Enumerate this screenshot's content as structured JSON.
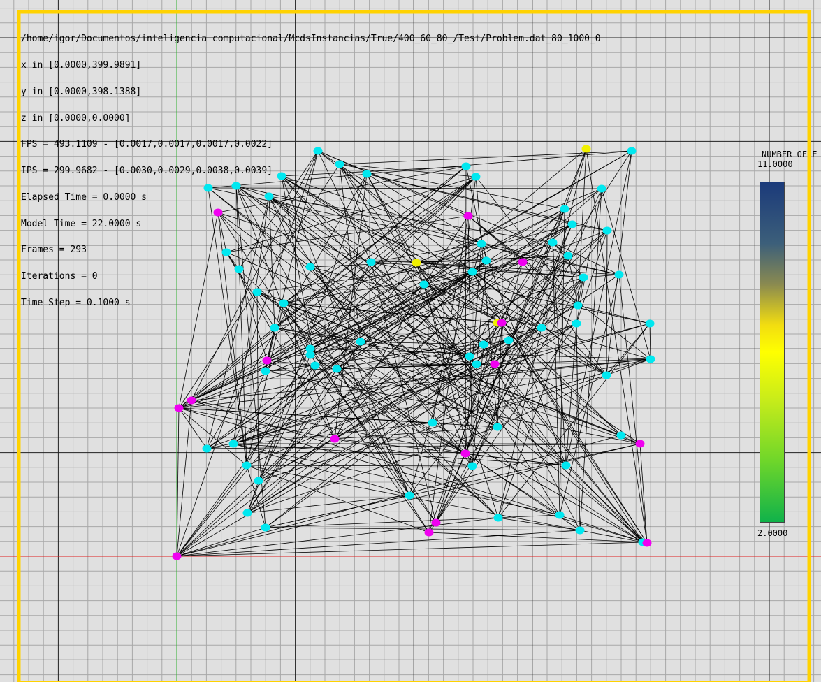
{
  "info": {
    "path": "/home/igor/Documentos/inteligencia computacional/McdsInstancias/True/400_60_80_/Test/Problem.dat_80_1000_0",
    "x_range": "x in [0.0000,399.9891]",
    "y_range": "y in [0.0000,398.1388]",
    "z_range": "z in [0.0000,0.0000]",
    "fps": "FPS = 493.1109 - [0.0017,0.0017,0.0017,0.0022]",
    "ips": "IPS = 299.9682 - [0.0030,0.0029,0.0038,0.0039]",
    "elapsed": "Elapsed Time = 0.0000 s",
    "model_time": "Model Time = 22.0000 s",
    "frames": "Frames = 293",
    "iterations": "Iterations = 0",
    "time_step": "Time Step = 0.1000 s"
  },
  "legend": {
    "title": "NUMBER_OF_E",
    "max": "11.0000",
    "min": "2.0000"
  },
  "colors": {
    "background": "#e0e0e0",
    "frame": "#ffd200",
    "grid_minor": "#a8a8a8",
    "grid_major": "#202020",
    "x_axis": "#e02020",
    "y_axis": "#30b030",
    "node_cyan": "#00e8f0",
    "node_magenta": "#f000f0",
    "node_yellow": "#f0f000",
    "edge": "#000000"
  }
}
